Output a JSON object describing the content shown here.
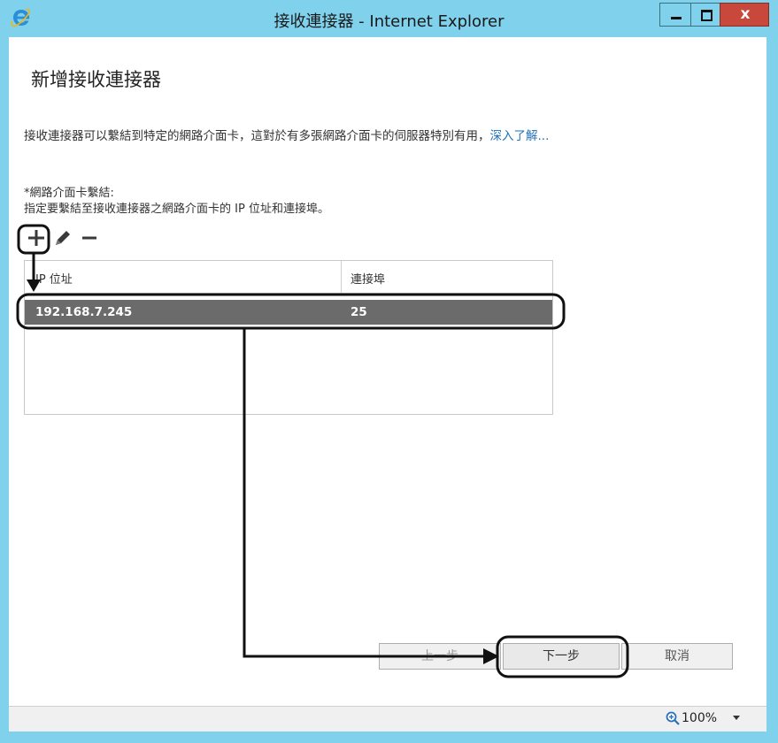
{
  "window": {
    "title": "接收連接器 - Internet Explorer",
    "close_glyph": "x"
  },
  "page": {
    "title": "新增接收連接器",
    "description": "接收連接器可以繫結到特定的網路介面卡，這對於有多張網路介面卡的伺服器特別有用，",
    "learn_more": "深入了解...",
    "binding_label": "*網路介面卡繫結:",
    "binding_hint": "指定要繫結至接收連接器之網路介面卡的 IP 位址和連接埠。"
  },
  "grid": {
    "columns": [
      "IP 位址",
      "連接埠"
    ],
    "rows": [
      {
        "ip": "192.168.7.245",
        "port": "25"
      }
    ]
  },
  "buttons": {
    "back": "上一步",
    "next": "下一步",
    "cancel": "取消"
  },
  "status": {
    "zoom": "100%"
  },
  "icons": {
    "app": "internet-explorer-icon",
    "add": "plus-icon",
    "edit": "pencil-icon",
    "remove": "minus-icon",
    "zoom": "magnifier-icon"
  },
  "colors": {
    "titlebar": "#7fd1ec",
    "close": "#c9483c",
    "selected_row": "#6b6b6b",
    "link": "#1e6fb8"
  }
}
